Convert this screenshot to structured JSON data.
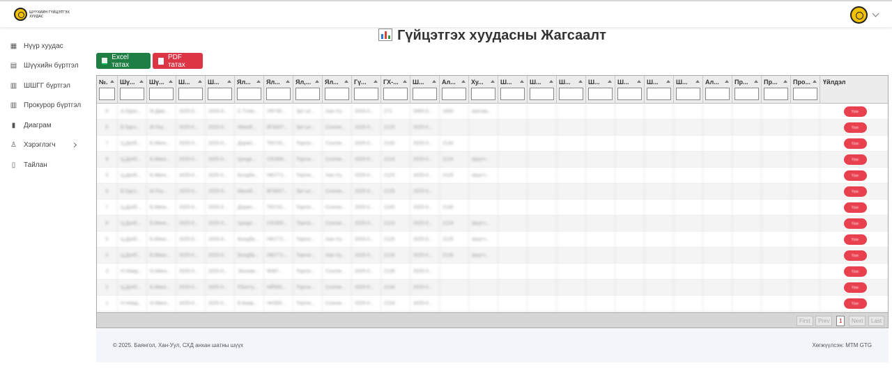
{
  "brand": {
    "logo_text": "ШҮҮХИЙН ГҮЙЦЭТГЭХ ХУУДАС",
    "seal_color": "#f2c200"
  },
  "user": {
    "avatar_icon": "court-seal-icon",
    "menu_icon": "chevron-down-icon"
  },
  "sidebar": {
    "items": [
      {
        "label": "Нүүр хуудас",
        "icon": "grid-icon",
        "glyph": "▦"
      },
      {
        "label": "Шүүхийн бүртгэл",
        "icon": "table-icon",
        "glyph": "▤"
      },
      {
        "label": "ШШГГ бүртгэл",
        "icon": "columns-icon",
        "glyph": "▥"
      },
      {
        "label": "Прокурор бүртгэл",
        "icon": "columns-icon",
        "glyph": "▥"
      },
      {
        "label": "Диаграм",
        "icon": "bar-chart-icon",
        "glyph": "▮"
      },
      {
        "label": "Хэрэглэгч",
        "icon": "user-icon",
        "glyph": "♙"
      },
      {
        "label": "Тайлан",
        "icon": "document-icon",
        "glyph": "▯"
      }
    ]
  },
  "page": {
    "title": "Гүйцэтгэх хуудасны Жагсаалт",
    "title_icon": "bar-chart-icon"
  },
  "toolbar": {
    "excel_label": "Excel татах",
    "pdf_label": "PDF татах",
    "excel_color": "#1e7e44",
    "pdf_color": "#dc3545"
  },
  "table": {
    "columns": [
      "№...",
      "Шү...",
      "Шү...",
      "Ш...",
      "Ш...",
      "Ял...",
      "Ял...",
      "Ял,...",
      "Ял...",
      "Гү...",
      "ГХ-...",
      "Ш...",
      "Ал...",
      "Ху...",
      "Ш...",
      "Ш...",
      "Ш...",
      "Ш...",
      "Ш...",
      "Ш...",
      "Ш...",
      "Ал...",
      "Пр...",
      "Пр...",
      "Про...",
      "Үйлдэл"
    ],
    "rows": [
      [
        "6",
        "А.Одон...",
        "М.Дам...",
        "2025-0...",
        "2025-0...",
        "С.Тэлм...",
        "УФ730...",
        "Зрт-ыг...",
        "Хан-Уу...",
        "2025-0...",
        "271",
        "0905-0...",
        "1800",
        "жагсаа..."
      ],
      [
        "5",
        "Б.Одгэ...",
        "М.Лхү...",
        "2025-0...",
        "2025-0...",
        "Мөнхб...",
        "ВГ8007...",
        "Зрт-ыг...",
        "Сонгин...",
        "2025-0...",
        "2125",
        "2025-0...",
        "",
        ""
      ],
      [
        "7",
        "Ц.Дэлб...",
        "Б.Мөнх...",
        "2025-0...",
        "2025-0...",
        "Доржп...",
        "ТЮ741...",
        "Торгох...",
        "Сонгин...",
        "2025-0...",
        "2140",
        "2025-0...",
        "2140",
        ""
      ],
      [
        "8",
        "Ц.Дэлб...",
        "Б.Мөнх...",
        "2025-0...",
        "2025-0...",
        "Цэнде...",
        "СЮ300...",
        "Торгох...",
        "Сонгин...",
        "2025-0...",
        "2124",
        "2025-0...",
        "2124",
        "Шүүгч..."
      ],
      [
        "5",
        "Ц.Дэлб...",
        "Б.Мөнх...",
        "2025-0...",
        "2025-0...",
        "Болдба...",
        "НЮ771...",
        "Торгох...",
        "Хан-Уу...",
        "2025-0...",
        "2125",
        "2025-0...",
        "2125",
        "Шүүгч..."
      ],
      [
        "6",
        "Б.Одгэ...",
        "М.Лхү...",
        "2025-0...",
        "2025-0...",
        "Мөнхб...",
        "ВГ8007...",
        "Зрт-ыг...",
        "Сонгин...",
        "2025-0...",
        "2125",
        "2025-0...",
        "",
        ""
      ],
      [
        "7",
        "Ц.Дэлб...",
        "Б.Мөнх...",
        "2025-0...",
        "2025-0...",
        "Доржп...",
        "ТЮ741...",
        "Торгох...",
        "Сонгин...",
        "2025-0...",
        "2140",
        "2025-0...",
        "2140",
        ""
      ],
      [
        "8",
        "Ц.Дэлб...",
        "Б.Мөнх...",
        "2025-0...",
        "2025-0...",
        "Цэнде...",
        "СЮ300...",
        "Торгох...",
        "Сонгин...",
        "2025-0...",
        "2124",
        "2025-0...",
        "2124",
        "Шүүгч..."
      ],
      [
        "5",
        "Ц.Дэлб...",
        "Б.Мөнх...",
        "2025-0...",
        "2025-0...",
        "Болдба...",
        "НЮ771...",
        "Торгох...",
        "Хан-Уу...",
        "2025-0...",
        "2125",
        "2025-0...",
        "2125",
        "Шүүгч..."
      ],
      [
        "4",
        "Ц.Дэлб...",
        "Б.Мөнх...",
        "2025-0...",
        "2025-0...",
        "Болдба...",
        "НЮ771...",
        "Торгох...",
        "Хан-Уу...",
        "2025-0...",
        "2126",
        "2025-0...",
        "2126",
        "Шүүгч..."
      ],
      [
        "3",
        "Н.Нямд...",
        "О.Мөнх...",
        "2025-0...",
        "2025-0...",
        "Ээлхам...",
        "Ф087...",
        "Торгох...",
        "Сонгин...",
        "2025-0...",
        "2139",
        "2025-0...",
        "",
        ""
      ],
      [
        "2",
        "Ц.Дэлб...",
        "Б.Мөнх...",
        "2025-0...",
        "2025-0...",
        "Р.Батту...",
        "НЙ900...",
        "Торгох...",
        "Сонгин...",
        "2025-0...",
        "2134",
        "2025-0...",
        "",
        ""
      ],
      [
        "1",
        "Н.Нямд...",
        "О.Мөнх...",
        "2025-0...",
        "2025-0...",
        "Б.Баяр...",
        "ЧН300...",
        "Торгох...",
        "Сонгин...",
        "2025-0...",
        "2153",
        "2025-0...",
        "",
        ""
      ]
    ],
    "action_label": "Үзэх"
  },
  "pagination": {
    "first": "First",
    "prev": "Prev",
    "current": "1",
    "next": "Next",
    "last": "Last"
  },
  "footer": {
    "copyright": "© 2025. Баянгол, Хан-Уул, СХД анхан шатны шүүх",
    "developer": "Хөгжүүлсэн: MTM GTG"
  }
}
